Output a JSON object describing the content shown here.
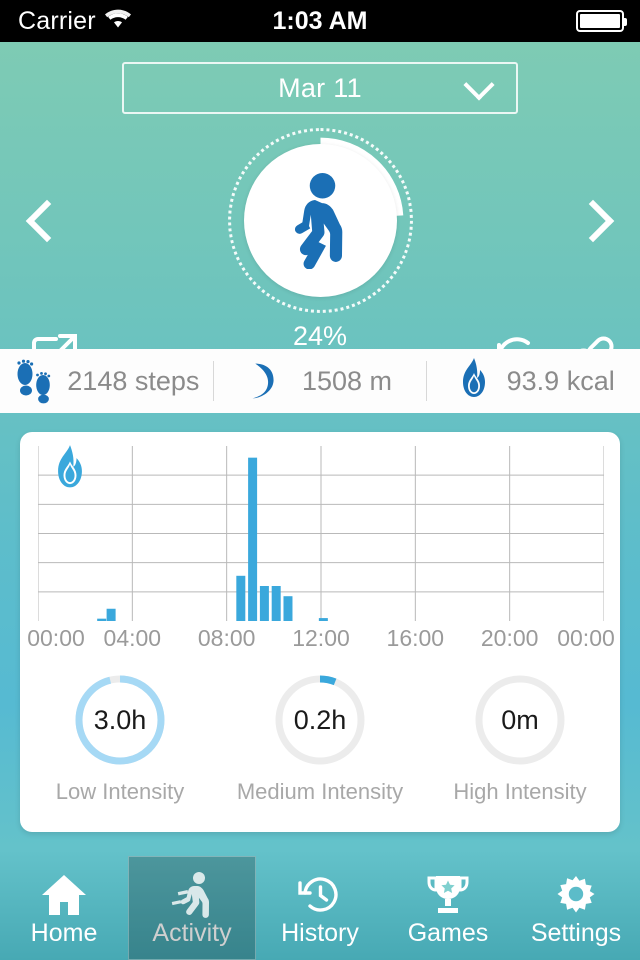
{
  "statusbar": {
    "carrier": "Carrier",
    "wifi_icon": "wifi-icon",
    "time": "1:03 AM",
    "battery_icon": "battery-icon"
  },
  "header": {
    "date_label": "Mar 11",
    "chevron_icon": "chevron-down-icon",
    "prev_icon": "chevron-left-icon",
    "next_icon": "chevron-right-icon"
  },
  "ring": {
    "percent_label": "24%",
    "percent_value": 24,
    "activity_icon": "walking-person-icon",
    "track_color": "#ffffff",
    "icon_color": "#1b6fb5"
  },
  "actions": {
    "share_icon": "share-export-icon",
    "sync_icon": "sync-refresh-icon",
    "link_icon": "link-chain-icon"
  },
  "stats": [
    {
      "icon": "footprints-icon",
      "value": "2148 steps"
    },
    {
      "icon": "route-path-icon",
      "value": "1508 m"
    },
    {
      "icon": "flame-icon",
      "value": "93.9 kcal"
    }
  ],
  "chart_data": {
    "type": "bar",
    "title": "",
    "subtitle": "",
    "xlabel": "",
    "ylabel": "",
    "series_icon": "flame-icon",
    "bar_color": "#3aa8dc",
    "grid": true,
    "legend": "none",
    "xlim": [
      0,
      24
    ],
    "ylim": [
      0,
      6
    ],
    "y_gridlines": [
      1,
      2,
      3,
      4,
      5,
      6
    ],
    "tick_labels": [
      "00:00",
      "04:00",
      "08:00",
      "12:00",
      "16:00",
      "20:00",
      "00:00"
    ],
    "tick_hours": [
      0,
      4,
      8,
      12,
      16,
      20,
      24
    ],
    "x": [
      2.7,
      3.1,
      8.6,
      9.1,
      9.6,
      10.1,
      10.6,
      12.1
    ],
    "values": [
      0.08,
      0.42,
      1.55,
      5.6,
      1.2,
      1.2,
      0.85,
      0.1
    ],
    "bars": [
      {
        "hour": 2.7,
        "value": 0.08
      },
      {
        "hour": 3.1,
        "value": 0.42
      },
      {
        "hour": 8.6,
        "value": 1.55
      },
      {
        "hour": 9.1,
        "value": 5.6
      },
      {
        "hour": 9.6,
        "value": 1.2
      },
      {
        "hour": 10.1,
        "value": 1.2
      },
      {
        "hour": 10.6,
        "value": 0.85
      },
      {
        "hour": 12.1,
        "value": 0.1
      }
    ]
  },
  "intensity": [
    {
      "value": "3.0h",
      "caption": "Low Intensity",
      "percent": 96,
      "color": "#a6d9f5"
    },
    {
      "value": "0.2h",
      "caption": "Medium Intensity",
      "percent": 6,
      "color": "#3aa8dc"
    },
    {
      "value": "0m",
      "caption": "High Intensity",
      "percent": 0,
      "color": "#ececec"
    }
  ],
  "tabs": [
    {
      "label": "Home",
      "icon": "home-icon",
      "active": false
    },
    {
      "label": "Activity",
      "icon": "running-icon",
      "active": true
    },
    {
      "label": "History",
      "icon": "history-icon",
      "active": false
    },
    {
      "label": "Games",
      "icon": "trophy-icon",
      "active": false
    },
    {
      "label": "Settings",
      "icon": "gear-icon",
      "active": false
    }
  ]
}
